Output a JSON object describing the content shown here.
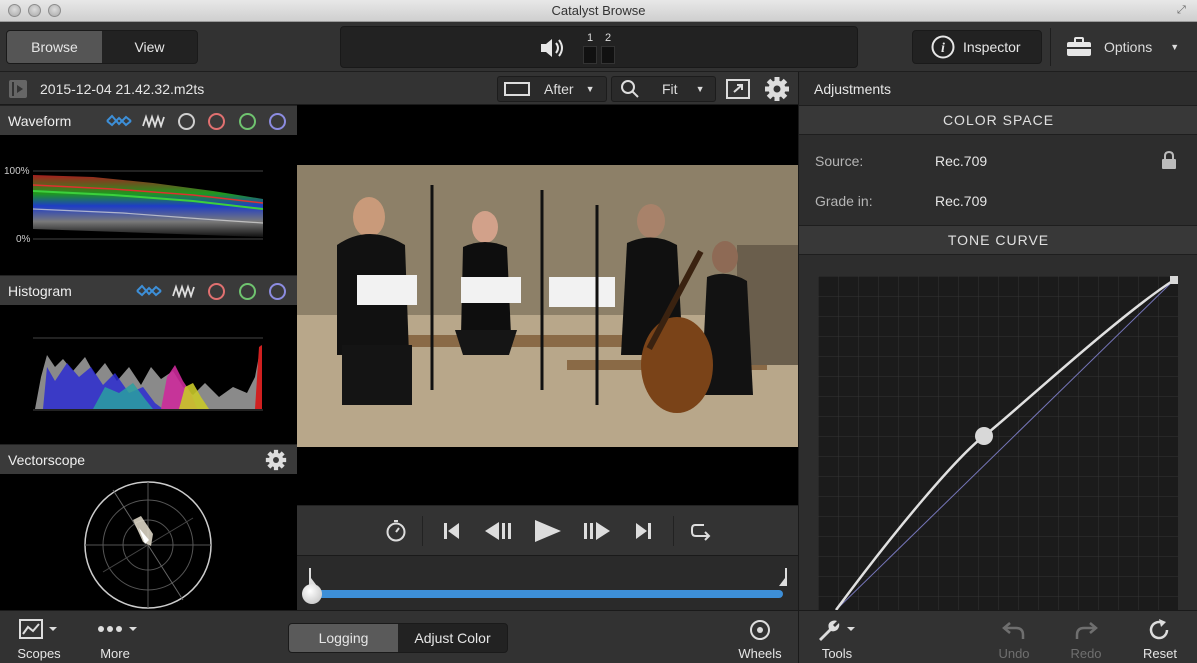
{
  "window": {
    "title": "Catalyst Browse"
  },
  "toolbar": {
    "browse_label": "Browse",
    "view_label": "View",
    "channel_1": "1",
    "channel_2": "2",
    "inspector_label": "Inspector",
    "options_label": "Options"
  },
  "filebar": {
    "filename": "2015-12-04 21.42.32.m2ts",
    "compare_mode": "After",
    "zoom_mode": "Fit"
  },
  "scopes": {
    "waveform": {
      "label": "Waveform",
      "top_label": "100%",
      "bottom_label": "0%"
    },
    "histogram": {
      "label": "Histogram"
    },
    "vectorscope": {
      "label": "Vectorscope"
    }
  },
  "adjustments": {
    "title": "Adjustments",
    "color_space": {
      "header": "COLOR SPACE",
      "source_label": "Source:",
      "source_value": "Rec.709",
      "grade_label": "Grade in:",
      "grade_value": "Rec.709"
    },
    "tone_curve": {
      "header": "TONE CURVE"
    }
  },
  "bottombar": {
    "scopes_label": "Scopes",
    "more_label": "More",
    "logging_label": "Logging",
    "adjust_color_label": "Adjust Color",
    "wheels_label": "Wheels",
    "tools_label": "Tools",
    "undo_label": "Undo",
    "redo_label": "Redo",
    "reset_label": "Reset"
  },
  "colors": {
    "accent_blue": "#3d8fd8",
    "red_channel": "#e07070",
    "green_channel": "#6fc36f",
    "blue_channel": "#8c8ce0"
  }
}
